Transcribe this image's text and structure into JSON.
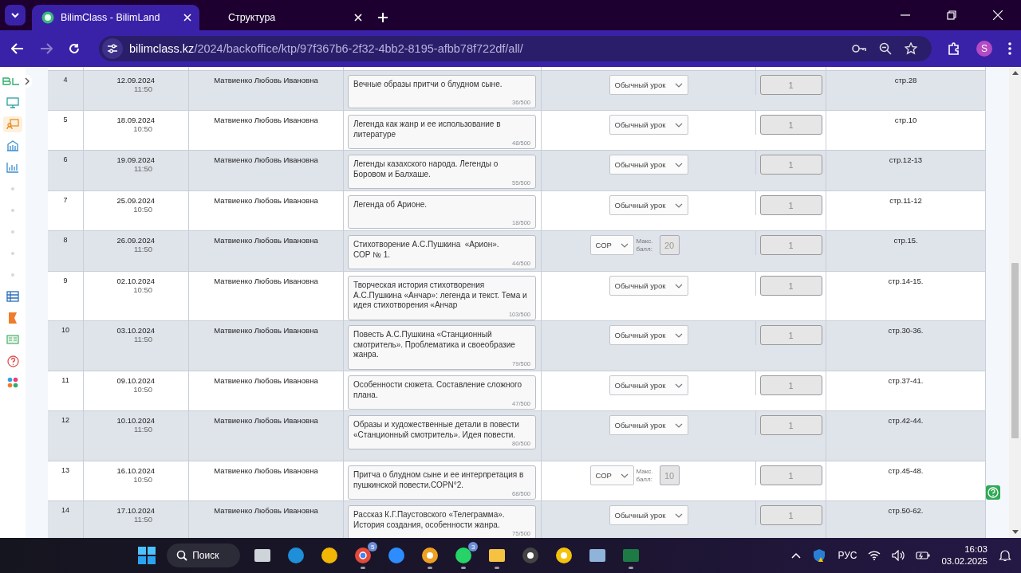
{
  "browser": {
    "tabs": [
      {
        "title": "BilimClass - BilimLand",
        "selected": true
      },
      {
        "title": "Структура",
        "selected": false
      }
    ],
    "url_host": "bilimclass.kz",
    "url_path": "/2024/backoffice/ktp/97f367b6-2f32-4bb2-8195-afbb78f722df/all/",
    "profile": "S"
  },
  "sidebar": {
    "items": [
      {
        "kind": "monitor",
        "selected": false
      },
      {
        "kind": "teacher",
        "selected": true
      },
      {
        "kind": "building",
        "selected": false
      },
      {
        "kind": "chart",
        "selected": false
      },
      {
        "kind": "dot",
        "selected": false
      },
      {
        "kind": "dot",
        "selected": false
      },
      {
        "kind": "dot",
        "selected": false
      },
      {
        "kind": "dot",
        "selected": false
      },
      {
        "kind": "dot",
        "selected": false
      },
      {
        "kind": "table",
        "selected": false
      },
      {
        "kind": "flag",
        "selected": false
      },
      {
        "kind": "card",
        "selected": false
      },
      {
        "kind": "help",
        "selected": false
      },
      {
        "kind": "apps",
        "selected": false
      }
    ]
  },
  "table": {
    "rows": [
      {
        "num": "4",
        "date": "12.09.2024",
        "time": "11:50",
        "teacher": "Матвиенко Любовь Ивановна",
        "topic": "Вечные образы притчи о блудном сыне.",
        "count": "36/500",
        "lesson": {
          "kind": "regular",
          "label": "Обычный урок"
        },
        "hours": "1",
        "pages": "стр.28"
      },
      {
        "num": "5",
        "date": "18.09.2024",
        "time": "10:50",
        "teacher": "Матвиенко Любовь Ивановна",
        "topic": "Легенда как жанр и ее использование в литературе",
        "count": "48/500",
        "lesson": {
          "kind": "regular",
          "label": "Обычный урок"
        },
        "hours": "1",
        "pages": "стр.10"
      },
      {
        "num": "6",
        "date": "19.09.2024",
        "time": "11:50",
        "teacher": "Матвиенко Любовь Ивановна",
        "topic": "Легенды казахского народа. Легенды о Боровом и Балхаше.",
        "count": "55/500",
        "lesson": {
          "kind": "regular",
          "label": "Обычный урок"
        },
        "hours": "1",
        "pages": "стр.12-13"
      },
      {
        "num": "7",
        "date": "25.09.2024",
        "time": "10:50",
        "teacher": "Матвиенко Любовь Ивановна",
        "topic": "Легенда об Арионе.",
        "count": "18/500",
        "lesson": {
          "kind": "regular",
          "label": "Обычный урок"
        },
        "hours": "1",
        "pages": "стр.11-12"
      },
      {
        "num": "8",
        "date": "26.09.2024",
        "time": "11:50",
        "teacher": "Матвиенко Любовь Ивановна",
        "topic": "Стихотворение А.С.Пушкина  «Арион».\nСОР № 1.",
        "count": "44/500",
        "lesson": {
          "kind": "sor",
          "label": "СОР",
          "max_label": "Макс. балл:",
          "max": "20"
        },
        "hours": "1",
        "pages": "стр.15."
      },
      {
        "num": "9",
        "date": "02.10.2024",
        "time": "10:50",
        "teacher": "Матвиенко Любовь Ивановна",
        "topic": "Творческая история стихотворения А.С.Пушкина «Анчар»: легенда и текст. Тема и идея стихотворения «Анчар",
        "count": "103/500",
        "lesson": {
          "kind": "regular",
          "label": "Обычный урок"
        },
        "hours": "1",
        "pages": "стр.14-15."
      },
      {
        "num": "10",
        "date": "03.10.2024",
        "time": "11:50",
        "teacher": "Матвиенко Любовь Ивановна",
        "topic": "Повесть А.С.Пушкина «Станционный смотритель». Проблематика и своеобразие жанра.",
        "count": "79/500",
        "lesson": {
          "kind": "regular",
          "label": "Обычный урок"
        },
        "hours": "1",
        "pages": "стр.30-36."
      },
      {
        "num": "11",
        "date": "09.10.2024",
        "time": "10:50",
        "teacher": "Матвиенко Любовь Ивановна",
        "topic": "Особенности сюжета. Составление сложного плана.",
        "count": "47/500",
        "lesson": {
          "kind": "regular",
          "label": "Обычный урок"
        },
        "hours": "1",
        "pages": "стр.37-41."
      },
      {
        "num": "12",
        "date": "10.10.2024",
        "time": "11:50",
        "teacher": "Матвиенко Любовь Ивановна",
        "topic": "Образы и художественные детали в повести «Станционный смотритель». Идея повести.",
        "count": "80/500",
        "lesson": {
          "kind": "regular",
          "label": "Обычный урок"
        },
        "hours": "1",
        "pages": "стр.42-44."
      },
      {
        "num": "13",
        "date": "16.10.2024",
        "time": "10:50",
        "teacher": "Матвиенко Любовь Ивановна",
        "topic": "Притча о блудном сыне и ее интерпретация в пушкинской повести.СОРN°2.",
        "count": "68/500",
        "lesson": {
          "kind": "sor",
          "label": "СОР",
          "max_label": "Макс. балл:",
          "max": "10"
        },
        "hours": "1",
        "pages": "стр.45-48."
      },
      {
        "num": "14",
        "date": "17.10.2024",
        "time": "11:50",
        "teacher": "Матвиенко Любовь Ивановна",
        "topic": "Рассказ К.Г.Паустовского «Телеграмма». История создания, особенности жанра.",
        "count": "75/500",
        "lesson": {
          "kind": "regular",
          "label": "Обычный урок"
        },
        "hours": "1",
        "pages": "стр.50-62."
      }
    ]
  },
  "taskbar": {
    "search": "Поиск",
    "apps": [
      {
        "kind": "taskview",
        "running": false
      },
      {
        "kind": "edge",
        "running": false
      },
      {
        "kind": "triangle",
        "running": false
      },
      {
        "kind": "chrome",
        "running": true,
        "badge": "5"
      },
      {
        "kind": "zoom",
        "running": false
      },
      {
        "kind": "music",
        "running": true
      },
      {
        "kind": "whatsapp",
        "running": true,
        "badge": "3"
      },
      {
        "kind": "folder",
        "running": true
      },
      {
        "kind": "obs",
        "running": false
      },
      {
        "kind": "ring",
        "running": false
      },
      {
        "kind": "keyboard",
        "running": false
      },
      {
        "kind": "excel",
        "running": true
      }
    ],
    "lang": "РУС",
    "time": "16:03",
    "date": "03.02.2025"
  }
}
